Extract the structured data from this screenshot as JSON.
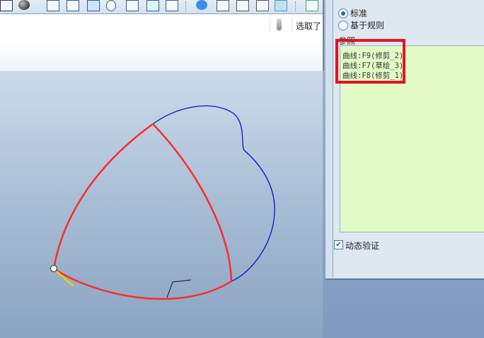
{
  "toolbar": {
    "icons": [
      "repaint-icon",
      "shading-sphere-icon",
      "layers-icon",
      "view-manager-icon",
      "sketch-view-icon",
      "zoom-in-icon",
      "zoom-fit-icon",
      "orientation-icon",
      "saved-views-icon",
      "display-style-icon",
      "wireframe-icon",
      "hidden-line-icon",
      "no-hidden-icon",
      "shaded-icon",
      "datum-icon"
    ]
  },
  "status": {
    "selection_text": "选取了"
  },
  "dialog": {
    "radio_standard": "标准",
    "radio_rule_based": "基于规则",
    "selected": "标准",
    "references_label": "参照",
    "references": [
      "曲线:F9(修剪_2)",
      "曲线:F7(草绘_3)",
      "曲线:F8(修剪_1)"
    ],
    "dynamic_validation": "动态验证",
    "dynamic_validation_checked": true
  },
  "colors": {
    "selected_curve": "#ff2b2b",
    "curve": "#1010d0",
    "highlight": "#e8111c",
    "list_bg": "#e2fbc6"
  }
}
